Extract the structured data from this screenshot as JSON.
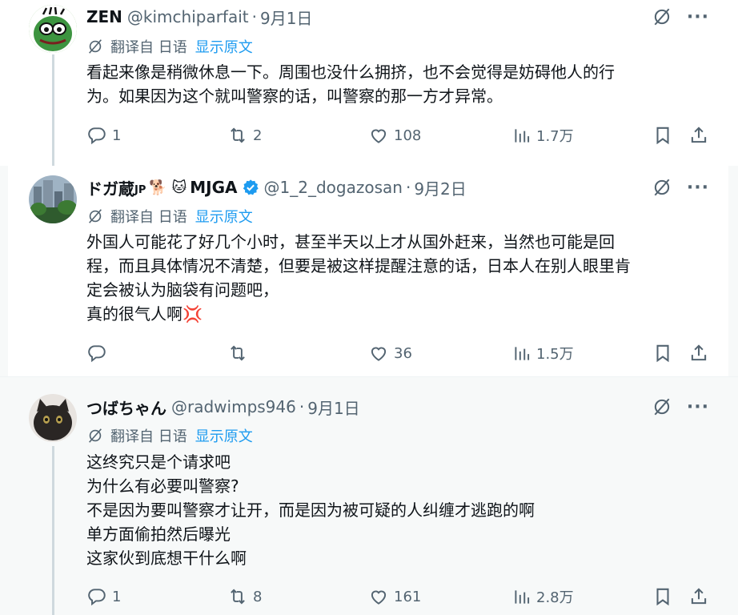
{
  "posts": [
    {
      "name": "ZEN",
      "handle": "@kimchiparfait",
      "date": "9月1日",
      "translate_label": "翻译自 日语",
      "show_original": "显示原文",
      "lines": [
        "看起来像是稍微休息一下。周围也没什么拥挤，也不会觉得是妨碍他人的行",
        "为。如果因为这个就叫警察的话，叫警察的那一方才异常。"
      ],
      "replies": "1",
      "reposts": "2",
      "likes": "108",
      "views": "1.7万"
    },
    {
      "name": "ドガ蔵",
      "name_suffix": "JP",
      "name_emoji": "🐕 🐱",
      "name_tail": "MJGA",
      "handle": "@1_2_dogazosan",
      "date": "9月2日",
      "translate_label": "翻译自 日语",
      "show_original": "显示原文",
      "lines": [
        "外国人可能花了好几个小时，甚至半天以上才从国外赶来，当然也可能是回",
        "程，而且具体情况不清楚，但要是被这样提醒注意的话，日本人在别人眼里肯",
        "定会被认为脑袋有问题吧，",
        "真的很气人啊💢"
      ],
      "replies": "",
      "reposts": "",
      "likes": "36",
      "views": "1.5万"
    },
    {
      "name": "つばちゃん",
      "handle": "@radwimps946",
      "date": "9月1日",
      "translate_label": "翻译自 日语",
      "show_original": "显示原文",
      "lines": [
        "这终究只是个请求吧",
        "为什么有必要叫警察?",
        "不是因为要叫警察才让开，而是因为被可疑的人纠缠才逃跑的啊",
        "单方面偷拍然后曝光",
        "这家伙到底想干什么啊"
      ],
      "replies": "1",
      "reposts": "8",
      "likes": "161",
      "views": "2.8万"
    }
  ],
  "icons": {
    "grok": "grok-icon",
    "more": "more-icon",
    "translate": "translate-icon",
    "reply": "reply-icon",
    "repost": "repost-icon",
    "like": "like-icon",
    "views": "views-icon",
    "bookmark": "bookmark-icon",
    "share": "share-icon"
  },
  "colors": {
    "link": "#1d9bf0",
    "secondary": "#536471",
    "verified": "#1d9bf0"
  }
}
